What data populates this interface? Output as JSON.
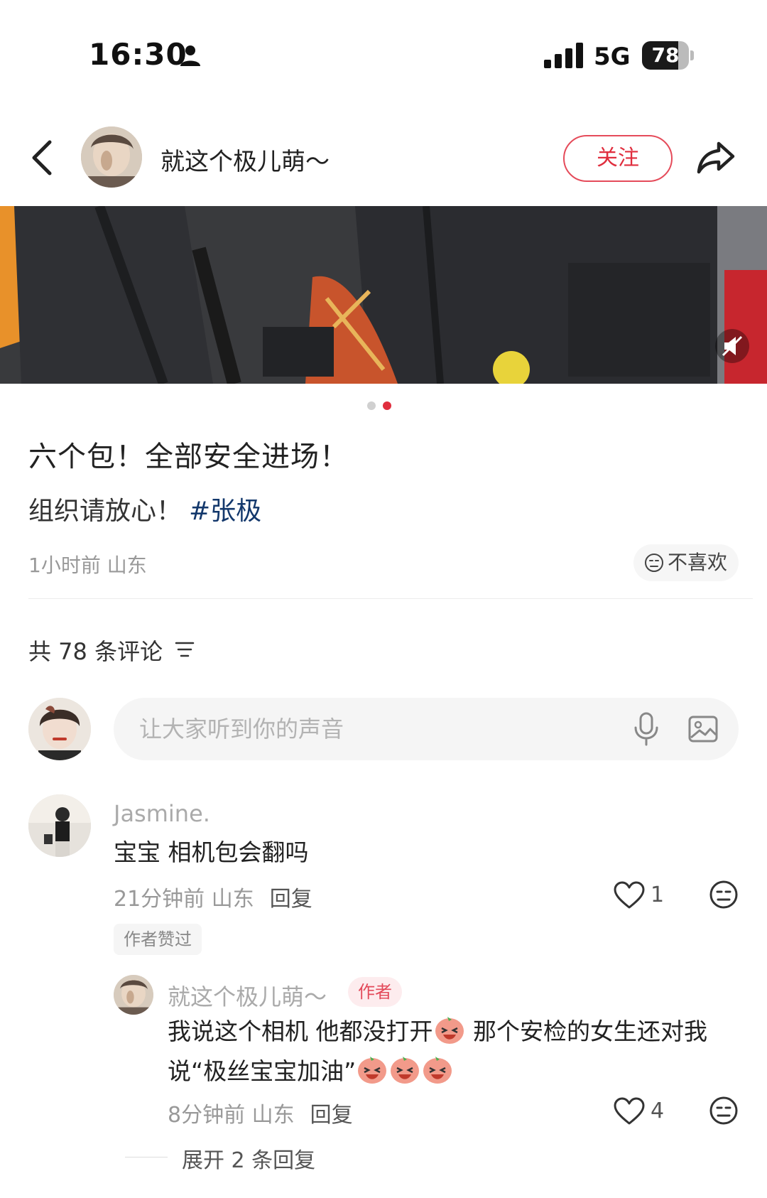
{
  "status_bar": {
    "time": "16:30",
    "network": "5G",
    "battery": "78",
    "battery_level": 0.78
  },
  "header": {
    "author_name": "就这个极儿萌～",
    "follow_label": "关注"
  },
  "post": {
    "image_pager": {
      "total": 2,
      "current": 2
    },
    "title": "六个包！全部安全进场！",
    "body_text": "组织请放心！",
    "hashtag": "#张极",
    "meta": "1小时前 山东",
    "dislike_label": "不喜欢"
  },
  "comments_section": {
    "count_label": "共 78 条评论",
    "input_placeholder": "让大家听到你的声音"
  },
  "comments": [
    {
      "user": "Jasmine.",
      "text": "宝宝 相机包会翻吗",
      "time_location": "21分钟前 山东",
      "reply_label": "回复",
      "likes": "1",
      "badge": "作者赞过"
    }
  ],
  "reply": {
    "user": "就这个极儿萌～",
    "author_tag": "作者",
    "text_line1_a": "我说这个相机 他都没打开",
    "text_line1_b": " 那个安检的女生还对我",
    "text_line2": "说“极丝宝宝加油”",
    "time_location": "8分钟前 山东",
    "reply_label": "回复",
    "likes": "4"
  },
  "expand_replies_label": "展开 2 条回复",
  "colors": {
    "accent": "#e02e3e",
    "hashtag": "#13386c",
    "muted": "#999999"
  }
}
